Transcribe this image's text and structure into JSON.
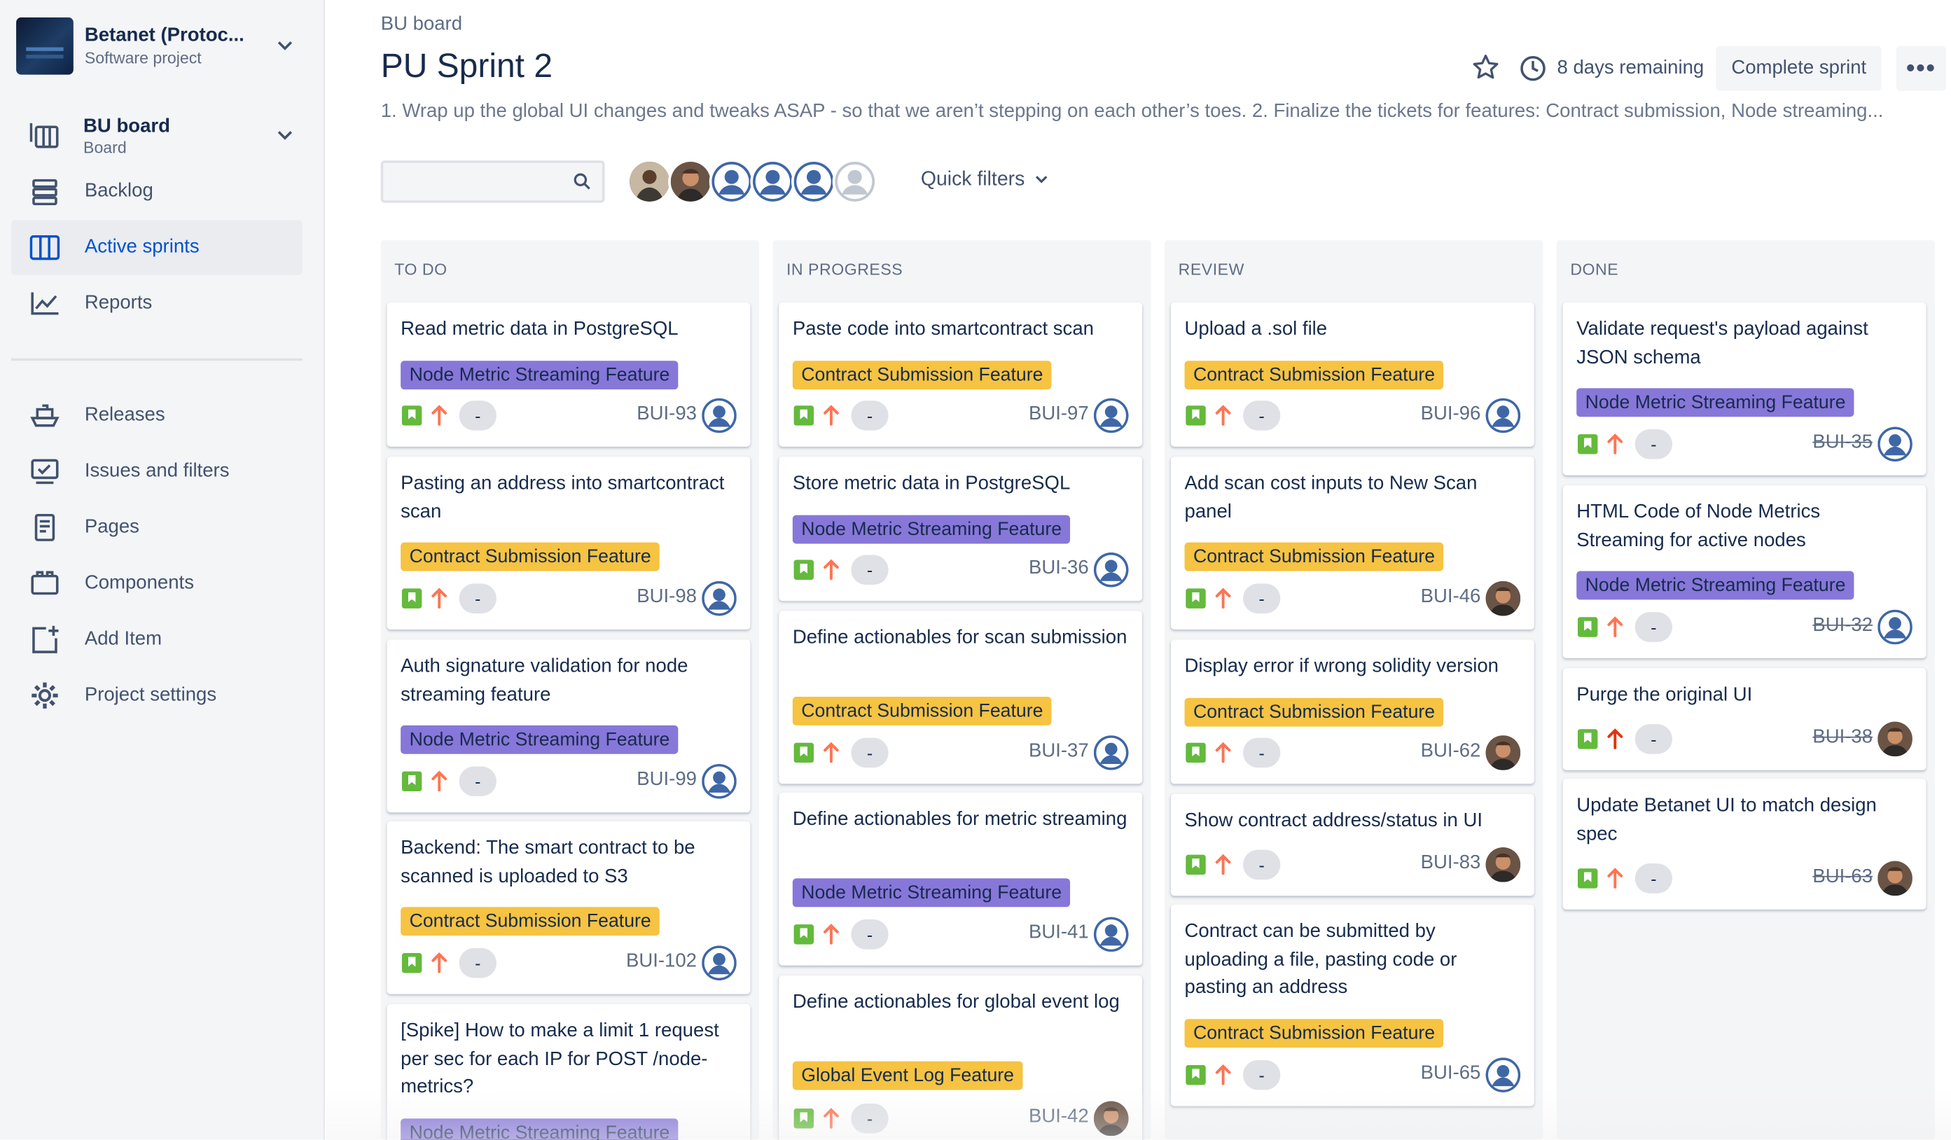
{
  "project": {
    "name": "Betanet (Protoc...",
    "type": "Software project"
  },
  "sidebar": {
    "board": {
      "label": "BU board",
      "sub": "Board"
    },
    "items": [
      {
        "label": "Backlog",
        "icon": "backlog-icon"
      },
      {
        "label": "Active sprints",
        "icon": "board-columns-icon"
      },
      {
        "label": "Reports",
        "icon": "reports-icon"
      },
      {
        "label": "Releases",
        "icon": "ship-icon"
      },
      {
        "label": "Issues and filters",
        "icon": "issues-icon"
      },
      {
        "label": "Pages",
        "icon": "page-icon"
      },
      {
        "label": "Components",
        "icon": "components-icon"
      },
      {
        "label": "Add Item",
        "icon": "add-item-icon"
      },
      {
        "label": "Project settings",
        "icon": "gear-icon"
      }
    ]
  },
  "header": {
    "breadcrumb": "BU board",
    "title": "PU Sprint 2",
    "remaining": "8 days remaining",
    "complete_label": "Complete sprint",
    "more_label": "•••",
    "description": "1. Wrap up the global UI changes and tweaks ASAP - so that we aren’t stepping on each other’s toes. 2. Finalize the tickets for features: Contract submission, Node streaming..."
  },
  "toolbar": {
    "quick_filters": "Quick filters"
  },
  "colors": {
    "purple_epic": "#8777d9",
    "yellow_epic": "#f6c342",
    "story_green": "#63ba3c",
    "priority_orange": "#ff7452",
    "link_blue": "#0052cc"
  },
  "columns": [
    {
      "title": "TO DO",
      "cards": [
        {
          "title": "Read metric data in PostgreSQL",
          "epic": "Node Metric Streaming Feature",
          "estimate": "-",
          "key": "BUI-93"
        },
        {
          "title": "Pasting an address into smartcontract scan",
          "epic": "Contract Submission Feature",
          "estimate": "-",
          "key": "BUI-98"
        },
        {
          "title": "Auth signature validation for node streaming feature",
          "epic": "Node Metric Streaming Feature",
          "estimate": "-",
          "key": "BUI-99"
        },
        {
          "title": "Backend: The smart contract to be scanned is uploaded to S3",
          "epic": "Contract Submission Feature",
          "estimate": "-",
          "key": "BUI-102"
        },
        {
          "title": "[Spike] How to make a limit 1 request per sec for each IP for POST /node-metrics?",
          "epic": "Node Metric Streaming Feature",
          "estimate": "",
          "key": ""
        }
      ]
    },
    {
      "title": "IN PROGRESS",
      "cards": [
        {
          "title": "Paste code into smartcontract scan",
          "epic": "Contract Submission Feature",
          "estimate": "-",
          "key": "BUI-97"
        },
        {
          "title": "Store metric data in PostgreSQL",
          "epic": "Node Metric Streaming Feature",
          "estimate": "-",
          "key": "BUI-36"
        },
        {
          "title": "Define actionables for scan submission",
          "epic": "Contract Submission Feature",
          "estimate": "-",
          "key": "BUI-37"
        },
        {
          "title": "Define actionables for metric streaming",
          "epic": "Node Metric Streaming Feature",
          "estimate": "-",
          "key": "BUI-41"
        },
        {
          "title": "Define actionables for global event log",
          "epic": "Global Event Log Feature",
          "estimate": "-",
          "key": "BUI-42"
        }
      ]
    },
    {
      "title": "REVIEW",
      "cards": [
        {
          "title": "Upload a .sol file",
          "epic": "Contract Submission Feature",
          "estimate": "-",
          "key": "BUI-96"
        },
        {
          "title": "Add scan cost inputs to New Scan panel",
          "epic": "Contract Submission Feature",
          "estimate": "-",
          "key": "BUI-46"
        },
        {
          "title": "Display error if wrong solidity version",
          "epic": "Contract Submission Feature",
          "estimate": "-",
          "key": "BUI-62"
        },
        {
          "title": "Show contract address/status in UI",
          "epic": "",
          "estimate": "-",
          "key": "BUI-83"
        },
        {
          "title": "Contract can be submitted by uploading a file, pasting code or pasting an address",
          "epic": "Contract Submission Feature",
          "estimate": "-",
          "key": "BUI-65"
        }
      ]
    },
    {
      "title": "DONE",
      "cards": [
        {
          "title": "Validate request's payload against JSON schema",
          "epic": "Node Metric Streaming Feature",
          "estimate": "-",
          "key": "BUI-35"
        },
        {
          "title": "HTML Code of Node Metrics Streaming for active nodes",
          "epic": "Node Metric Streaming Feature",
          "estimate": "-",
          "key": "BUI-32"
        },
        {
          "title": "Purge the original UI",
          "epic": "",
          "estimate": "-",
          "key": "BUI-38"
        },
        {
          "title": "Update Betanet UI to match design spec",
          "epic": "",
          "estimate": "-",
          "key": "BUI-63"
        }
      ]
    }
  ]
}
